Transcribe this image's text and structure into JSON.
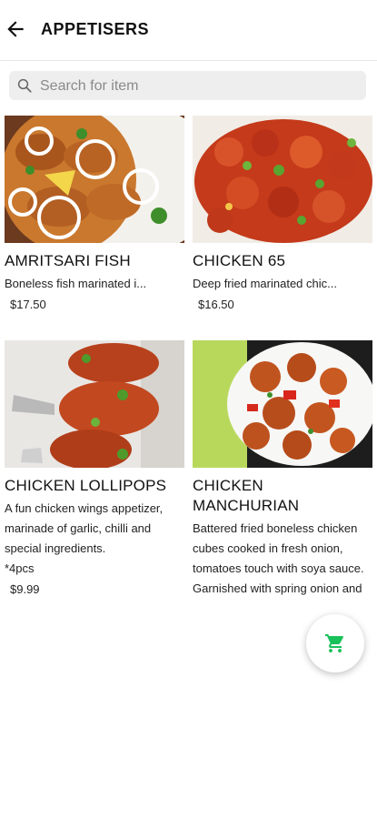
{
  "header": {
    "title": "APPETISERS"
  },
  "search": {
    "placeholder": "Search for item"
  },
  "items": [
    {
      "name": "AMRITSARI FISH",
      "description": "Boneless fish marinated i...",
      "price": "$17.50"
    },
    {
      "name": "CHICKEN 65",
      "description": "Deep fried marinated chic...",
      "price": "$16.50"
    },
    {
      "name": "CHICKEN LOLLIPOPS",
      "description": "A fun chicken wings appetizer, marinade of garlic, chilli and special ingredients.",
      "description_note": "*4pcs",
      "price": "$9.99"
    },
    {
      "name": "CHICKEN MANCHURIAN",
      "description": "Battered fried boneless chicken cubes cooked in fresh onion, tomatoes touch with soya sauce. Garnished with spring onion and coriander. please add a note if you would like to have it dry or..."
    }
  ],
  "colors": {
    "accent": "#19c15a",
    "search_bg": "#eeeeee"
  },
  "icons": {
    "back": "arrow-left-icon",
    "search": "search-icon",
    "cart": "cart-icon"
  }
}
